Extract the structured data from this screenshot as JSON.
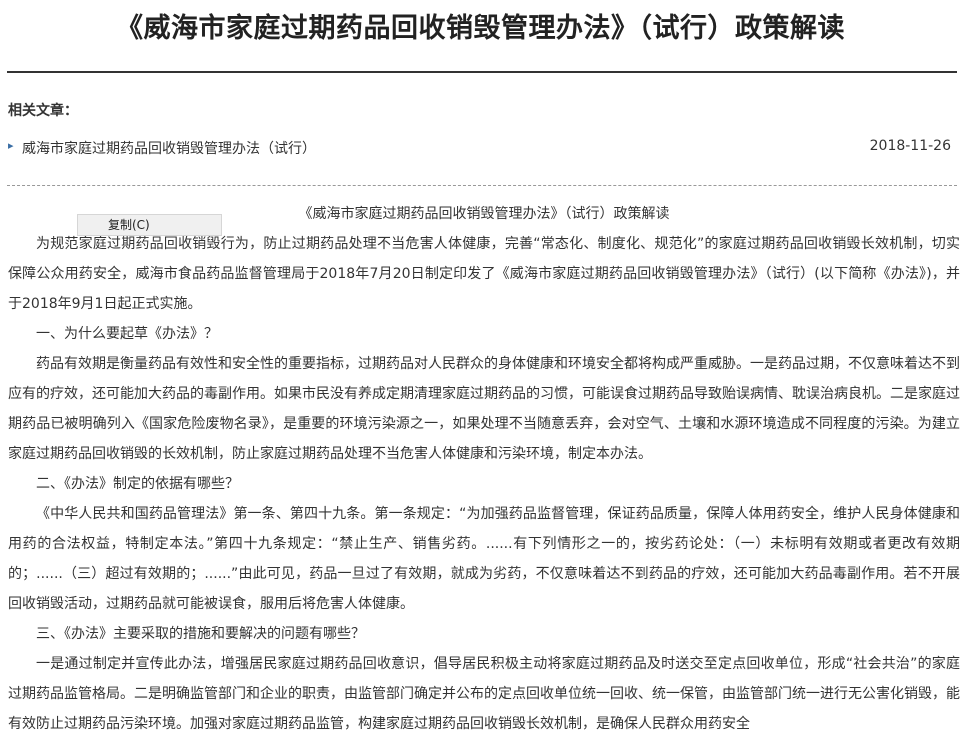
{
  "page": {
    "title": "《威海市家庭过期药品回收销毁管理办法》（试行）政策解读"
  },
  "related": {
    "heading": "相关文章：",
    "items": [
      {
        "label": "威海市家庭过期药品回收销毁管理办法（试行）",
        "date": "2018-11-26"
      }
    ]
  },
  "context_menu": {
    "copy_label": "复制(C)"
  },
  "article": {
    "heading": "《威海市家庭过期药品回收销毁管理办法》（试行）政策解读",
    "paragraphs": [
      "为规范家庭过期药品回收销毁行为，防止过期药品处理不当危害人体健康，完善“常态化、制度化、规范化”的家庭过期药品回收销毁长效机制，切实保障公众用药安全，威海市食品药品监督管理局于2018年7月20日制定印发了《威海市家庭过期药品回收销毁管理办法》（试行）(以下简称《办法》)，并于2018年9月1日起正式实施。",
      "一、为什么要起草《办法》？",
      "药品有效期是衡量药品有效性和安全性的重要指标，过期药品对人民群众的身体健康和环境安全都将构成严重威胁。一是药品过期，不仅意味着达不到应有的疗效，还可能加大药品的毒副作用。如果市民没有养成定期清理家庭过期药品的习惯，可能误食过期药品导致贻误病情、耽误治病良机。二是家庭过期药品已被明确列入《国家危险废物名录》，是重要的环境污染源之一，如果处理不当随意丢弃，会对空气、土壤和水源环境造成不同程度的污染。为建立家庭过期药品回收销毁的长效机制，防止家庭过期药品处理不当危害人体健康和污染环境，制定本办法。",
      "二、《办法》制定的依据有哪些？",
      "《中华人民共和国药品管理法》第一条、第四十九条。第一条规定：“为加强药品监督管理，保证药品质量，保障人体用药安全，维护人民身体健康和用药的合法权益，特制定本法。”第四十九条规定：“禁止生产、销售劣药。......有下列情形之一的，按劣药论处：（一）未标明有效期或者更改有效期的；......（三）超过有效期的；......”由此可见，药品一旦过了有效期，就成为劣药，不仅意味着达不到药品的疗效，还可能加大药品毒副作用。若不开展回收销毁活动，过期药品就可能被误食，服用后将危害人体健康。",
      "三、《办法》主要采取的措施和要解决的问题有哪些？",
      "一是通过制定并宣传此办法，增强居民家庭过期药品回收意识，倡导居民积极主动将家庭过期药品及时送交至定点回收单位，形成“社会共治”的家庭过期药品监管格局。二是明确监管部门和企业的职责，由监管部门确定并公布的定点回收单位统一回收、统一保管，由监管部门统一进行无公害化销毁，能有效防止过期药品污染环境。加强对家庭过期药品监管，构建家庭过期药品回收销毁长效机制，是确保人民群众用药安全"
    ]
  }
}
